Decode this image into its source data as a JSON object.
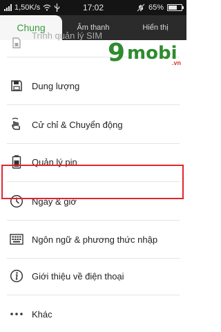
{
  "status_bar": {
    "network_speed": "1,50K/s",
    "time": "17:02",
    "battery": "65%",
    "battery_level": 0.65
  },
  "tabs": [
    {
      "label": "Chung",
      "active": true
    },
    {
      "label": "Âm thanh",
      "active": false
    },
    {
      "label": "Hiển thị",
      "active": false
    }
  ],
  "watermark": {
    "nine": "9",
    "mobi": "mobi",
    "tld": ".vn"
  },
  "menu": {
    "items": [
      {
        "label": "Trình quản lý SIM",
        "icon": "sim-icon"
      },
      {
        "label": "Dung lượng",
        "icon": "storage-icon"
      },
      {
        "label": "Cử chỉ & Chuyển động",
        "icon": "gesture-icon"
      },
      {
        "label": "Quản lý pin",
        "icon": "battery-icon"
      },
      {
        "label": "Ngày & giờ",
        "icon": "clock-icon"
      },
      {
        "label": "Ngôn ngữ & phương thức nhập",
        "icon": "keyboard-icon"
      },
      {
        "label": "Giới thiệu về điện thoại",
        "icon": "info-icon"
      },
      {
        "label": "Khác",
        "icon": "more-icon"
      }
    ]
  },
  "colors": {
    "accent_green": "#3a9a3c",
    "highlight_red": "#e0262b",
    "tab_bar": "#2b2b2b",
    "status_bar": "#141414"
  }
}
